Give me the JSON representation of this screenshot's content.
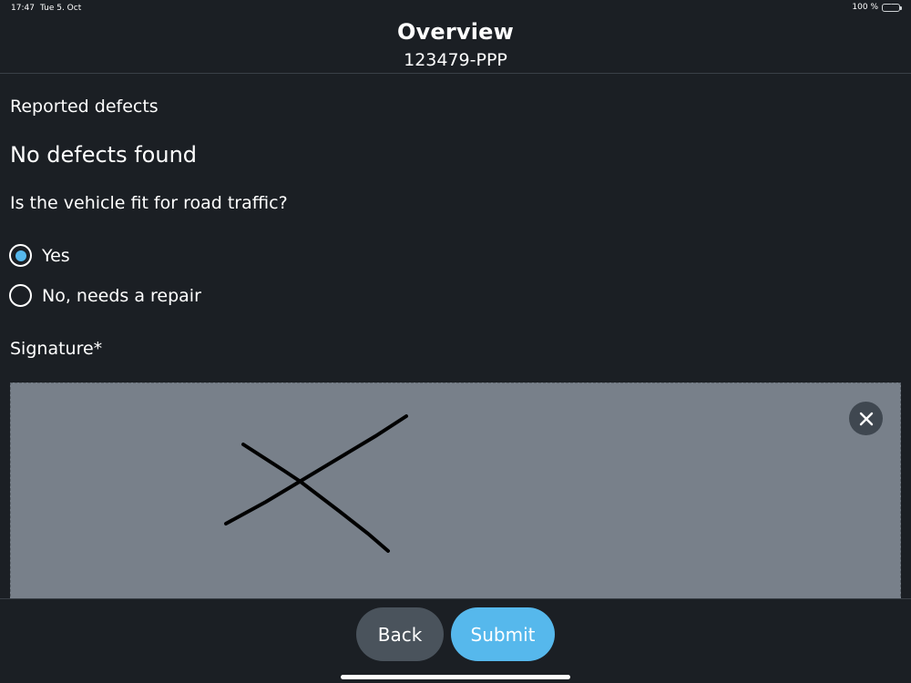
{
  "status_bar": {
    "time": "17:47",
    "date": "Tue 5. Oct",
    "battery": "100 %",
    "battery_level": 1.0
  },
  "header": {
    "title": "Overview",
    "subtitle": "123479-PPP"
  },
  "form": {
    "reported_label": "Reported defects",
    "defects_value": "No defects found",
    "question": "Is the vehicle fit for road traffic?",
    "options": [
      {
        "label": "Yes",
        "selected": true
      },
      {
        "label": "No, needs a repair",
        "selected": false
      }
    ],
    "signature_label": "Signature*",
    "clear_icon": "close-icon"
  },
  "footer": {
    "back_label": "Back",
    "submit_label": "Submit"
  },
  "colors": {
    "background": "#1b1f24",
    "accent": "#56b8ec",
    "signature_pad": "#78808a",
    "back_button": "#4a535c"
  }
}
